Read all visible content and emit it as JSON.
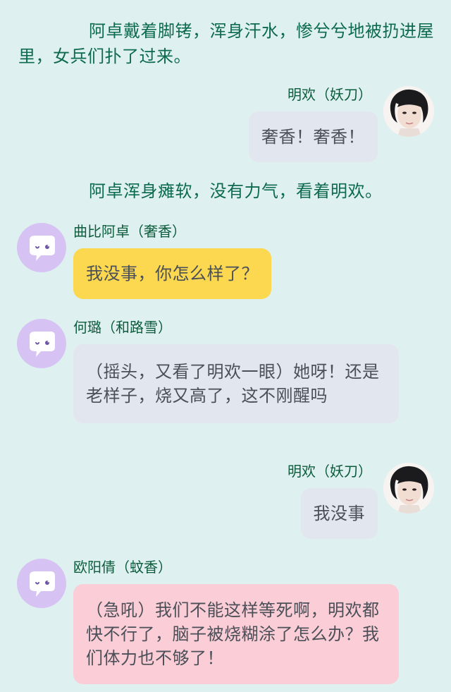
{
  "messages": [
    {
      "type": "narration",
      "text": "阿卓戴着脚铐，浑身汗水，惨兮兮地被扔进屋里，女兵们扑了过来。"
    },
    {
      "type": "right",
      "speaker": "明欢（妖刀）",
      "text": "奢香！奢香！",
      "bubble_color": "#e2e6ee"
    },
    {
      "type": "narration",
      "text": "阿卓浑身瘫软，没有力气，看着明欢。"
    },
    {
      "type": "left",
      "speaker": "曲比阿卓（奢香）",
      "text": "我没事，你怎么样了？",
      "bubble_color": "#fbd84f"
    },
    {
      "type": "left",
      "speaker": "何璐（和路雪）",
      "text": "（摇头，又看了明欢一眼）她呀！还是老样子，烧又高了，这不刚醒吗",
      "bubble_color": "#e2e6ee"
    },
    {
      "type": "right",
      "speaker": "明欢（妖刀）",
      "text": "我没事",
      "bubble_color": "#e2e6ee"
    },
    {
      "type": "left",
      "speaker": "欧阳倩（蚊香）",
      "text": "（急吼）我们不能这样等死啊，明欢都快不行了，脑子被烧糊涂了怎么办？我们体力也不够了！",
      "bubble_color": "#fbcdd6"
    }
  ],
  "colors": {
    "background": "#dff0f0",
    "narration_text": "#0c6a4e",
    "speaker_name": "#0c5c3c",
    "bubble_text": "#4a4f58",
    "bot_avatar": "#d6c3f3"
  },
  "icons": {
    "right_avatar": "user-photo-avatar",
    "left_avatar": "chat-bubble-bot-avatar"
  }
}
